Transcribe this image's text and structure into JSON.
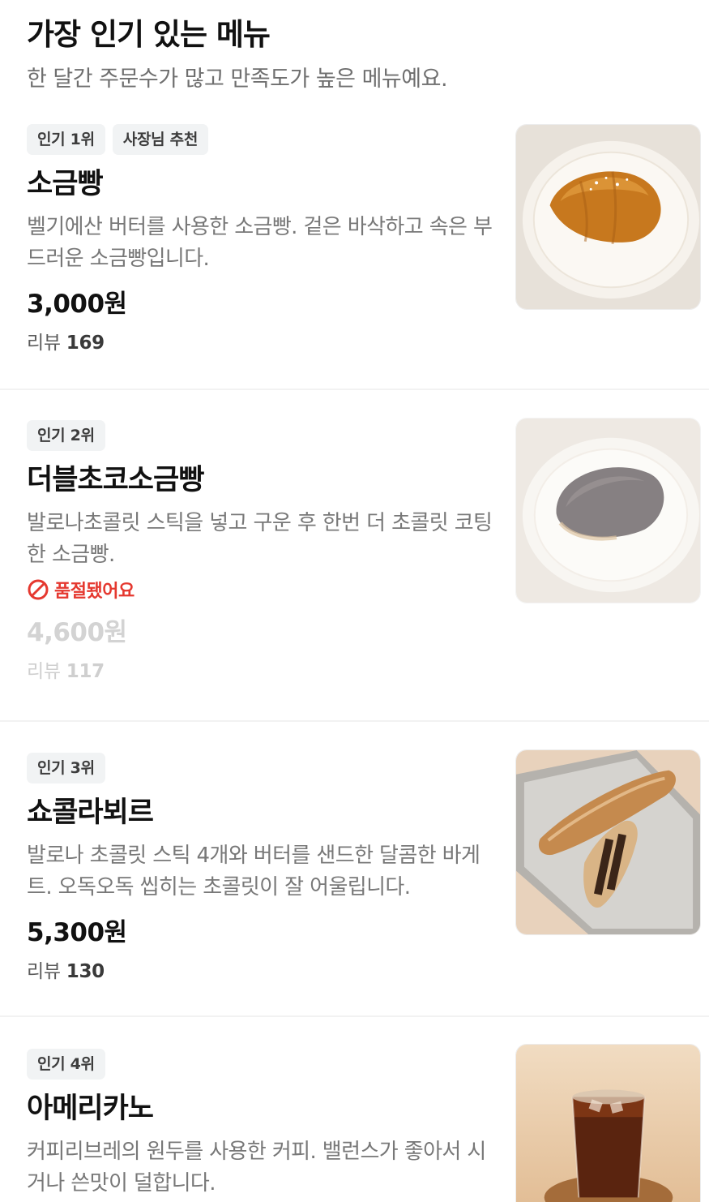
{
  "section": {
    "title": "가장 인기 있는 메뉴",
    "subtitle": "한 달간 주문수가 많고 만족도가 높은 메뉴예요."
  },
  "items": [
    {
      "badges": [
        "인기 1위",
        "사장님 추천"
      ],
      "name": "소금빵",
      "description": "벨기에산 버터를 사용한 소금빵. 겉은 바삭하고 속은 부드러운 소금빵입니다.",
      "price": "3,000원",
      "review_label": "리뷰",
      "review_count": "169",
      "image_icon": "salt-bread-photo"
    },
    {
      "badges": [
        "인기 2위"
      ],
      "name": "더블초코소금빵",
      "description": "발로나초콜릿 스틱을 넣고 구운 후 한번 더 초콜릿 코팅한 소금빵.",
      "status": "품절됐어요",
      "status_color": "#e5382f",
      "price": "4,600원",
      "review_label": "리뷰",
      "review_count": "117",
      "image_icon": "chocolate-salt-bread-photo"
    },
    {
      "badges": [
        "인기 3위"
      ],
      "name": "쇼콜라뵈르",
      "description": "발로나 초콜릿 스틱 4개와 버터를 샌드한 달콤한 바게트. 오독오독 씹히는 초콜릿이 잘 어울립니다.",
      "price": "5,300원",
      "review_label": "리뷰",
      "review_count": "130",
      "image_icon": "chocolat-beurre-baguette-photo"
    },
    {
      "badges": [
        "인기 4위"
      ],
      "name": "아메리카노",
      "description": "커피리브레의 원두를 사용한 커피. 밸런스가 좋아서 시거나 쓴맛이 덜합니다.",
      "image_icon": "iced-americano-photo"
    }
  ]
}
